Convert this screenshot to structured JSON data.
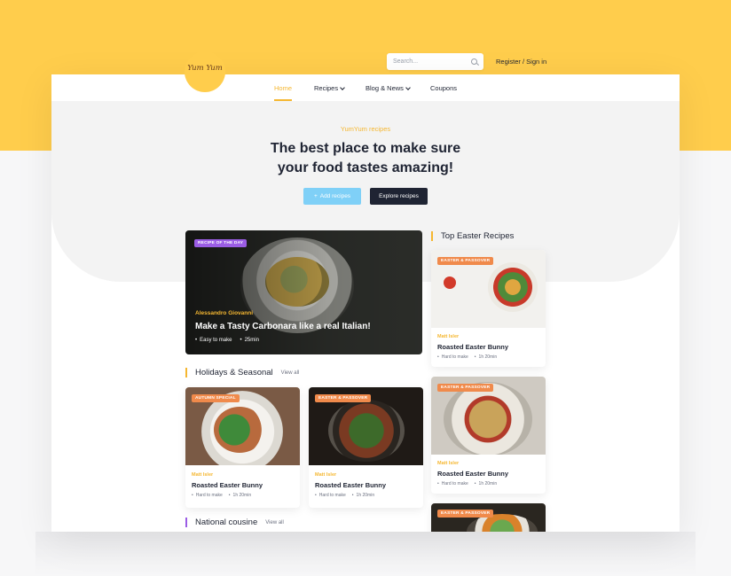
{
  "brand": {
    "logo_text": "Yum Yum"
  },
  "search": {
    "placeholder": "Search..."
  },
  "auth": {
    "label": "Register / Sign in"
  },
  "nav": {
    "items": [
      {
        "label": "Home",
        "active": true
      },
      {
        "label": "Recipes",
        "dropdown": true
      },
      {
        "label": "Blog & News",
        "dropdown": true
      },
      {
        "label": "Coupons"
      }
    ]
  },
  "hero": {
    "eyebrow": "YumYum recipes",
    "headline_line1": "The best place to make sure",
    "headline_line2": "your food tastes amazing!",
    "add_button": "Add recipes",
    "add_icon": "+",
    "explore_button": "Explore recipes"
  },
  "featured": {
    "badge": "RECIPE OF THE DAY",
    "author": "Alessandro Giovanni",
    "title": "Make a Tasty Carbonara like a real Italian!",
    "difficulty": "Easy to make",
    "time": "25min"
  },
  "sections": {
    "holidays": {
      "title": "Holidays & Seasonal",
      "view_all": "View all"
    },
    "national": {
      "title": "National cousine",
      "view_all": "View all"
    },
    "top_easter": {
      "title": "Top Easter Recipes"
    }
  },
  "holiday_cards": [
    {
      "badge": "AUTUMN SPECIAL",
      "author": "Matt Isler",
      "title": "Roasted Easter Bunny",
      "difficulty": "Hard to make",
      "time": "1h 20min"
    },
    {
      "badge": "EASTER & PASSOVER",
      "author": "Matt Isler",
      "title": "Roasted Easter Bunny",
      "difficulty": "Hard to make",
      "time": "1h 20min"
    }
  ],
  "easter_cards": [
    {
      "badge": "EASTER & PASSOVER",
      "author": "Matt Isler",
      "title": "Roasted Easter Bunny",
      "difficulty": "Hard to make",
      "time": "1h 20min"
    },
    {
      "badge": "EASTER & PASSOVER",
      "author": "Matt Isler",
      "title": "Roasted Easter Bunny",
      "difficulty": "Hard to make",
      "time": "1h 20min"
    },
    {
      "badge": "EASTER & PASSOVER"
    }
  ],
  "colors": {
    "brand_yellow": "#ffcd4c",
    "accent": "#f5b731",
    "dark": "#1f2433",
    "add_button": "#7fd0f7",
    "badge_purple": "#9b5de5",
    "badge_orange": "#f08a4b"
  }
}
